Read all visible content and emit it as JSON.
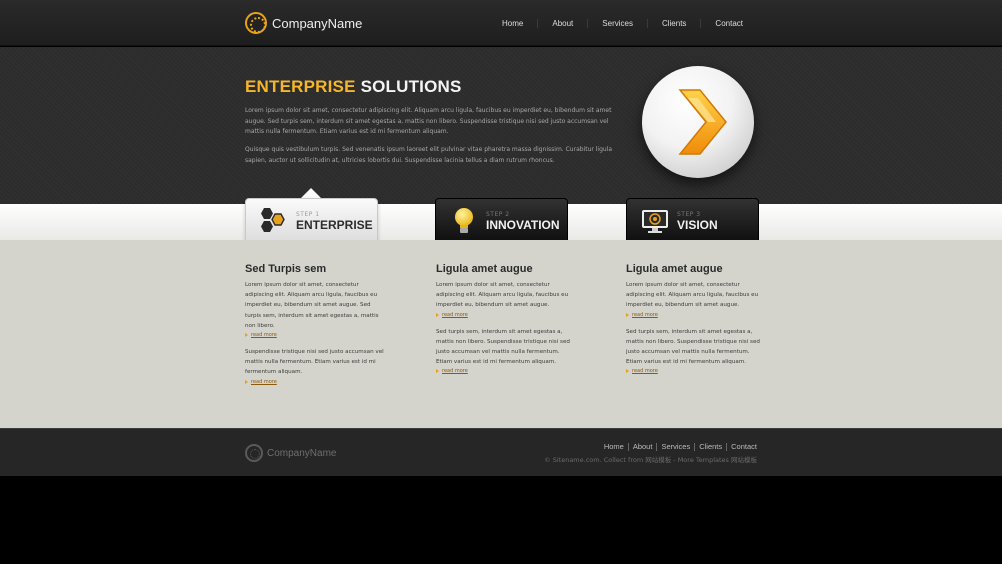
{
  "header": {
    "logo_text": "CompanyName",
    "nav": [
      "Home",
      "About",
      "Services",
      "Clients",
      "Contact"
    ]
  },
  "hero": {
    "title_accent": "ENTERPRISE",
    "title_rest": "SOLUTIONS",
    "paragraph1": "Lorem ipsum dolor sit amet, consectetur adipiscing elit. Aliquam arcu ligula, faucibus eu imperdiet eu, bibendum sit amet augue. Sed turpis sem, interdum sit amet egestas a, mattis non libero. Suspendisse tristique nisi sed justo accumsan vel mattis nulla fermentum. Etiam varius est id mi fermentum aliquam.",
    "paragraph2": "Quisque quis vestibulum turpis. Sed venenatis ipsum laoreet elit pulvinar vitae pharetra massa dignissim. Curabitur ligula sapien, auctor ut sollicitudin at, ultricies lobortis dui. Suspendisse lacinia tellus a diam rutrum rhoncus."
  },
  "tabs": [
    {
      "step": "STEP 1",
      "name": "ENTERPRISE",
      "icon": "hexagons-icon",
      "active": true
    },
    {
      "step": "STEP 2",
      "name": "INNOVATION",
      "icon": "lightbulb-icon",
      "active": false
    },
    {
      "step": "STEP 3",
      "name": "VISION",
      "icon": "monitor-icon",
      "active": false
    }
  ],
  "columns": [
    {
      "title": "Sed Turpis sem",
      "p1": "Lorem ipsum dolor sit amet, consectetur adipiscing elit. Aliquam arcu ligula, faucibus eu imperdiet eu, bibendum sit amet augue. Sed turpis sem, interdum sit amet egestas a, mattis non libero.",
      "more1": "read more",
      "p2": "Suspendisse tristique nisi sed justo accumsan vel mattis nulla fermentum. Etiam varius est id mi fermentum aliquam.",
      "more2": "read more"
    },
    {
      "title": "Ligula amet augue",
      "p1": "Lorem ipsum dolor sit amet, consectetur adipiscing elit. Aliquam arcu ligula, faucibus eu imperdiet eu, bibendum sit amet augue.",
      "more1": "read more",
      "p2": "Sed turpis sem, interdum sit amet egestas a, mattis non libero. Suspendisse tristique nisi sed justo accumsan vel mattis nulla fermentum. Etiam varius est id mi fermentum aliquam.",
      "more2": "read more"
    },
    {
      "title": "Ligula amet augue",
      "p1": "Lorem ipsum dolor sit amet, consectetur adipiscing elit. Aliquam arcu ligula, faucibus eu imperdiet eu, bibendum sit amet augue.",
      "more1": "read more",
      "p2": "Sed turpis sem, interdum sit amet egestas a, mattis non libero. Suspendisse tristique nisi sed justo accumsan vel mattis nulla fermentum. Etiam varius est id mi fermentum aliquam.",
      "more2": "read more"
    }
  ],
  "footer": {
    "logo_text": "CompanyName",
    "nav": [
      "Home",
      "About",
      "Services",
      "Clients",
      "Contact"
    ],
    "copyright": "© Sitename.com. Collect from 网站模板 - More Templates 网站模板"
  },
  "colors": {
    "accent": "#f5b62a",
    "header_bg": "#222222",
    "content_bg": "#d4d4cd"
  }
}
